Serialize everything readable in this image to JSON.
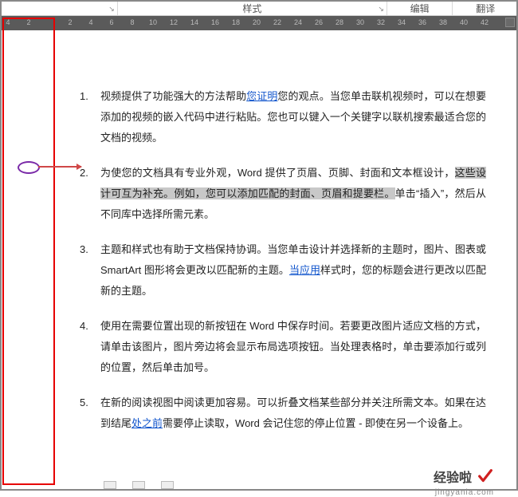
{
  "ribbon": {
    "styles_label": "样式",
    "edit_label": "编辑",
    "translate_label": "翻译"
  },
  "ruler": {
    "ticks": [
      "4",
      "2",
      "",
      "2",
      "4",
      "6",
      "8",
      "10",
      "12",
      "14",
      "16",
      "18",
      "20",
      "22",
      "24",
      "26",
      "28",
      "30",
      "32",
      "34",
      "36",
      "38",
      "40",
      "42"
    ]
  },
  "doc": {
    "items": [
      {
        "num": "1.",
        "pre": "视频提供了功能强大的方法帮助",
        "link1": "您证明",
        "post": "您的观点。当您单击联机视频时，可以在想要添加的视频的嵌入代码中进行粘贴。您也可以键入一个关键字以联机搜索最适合您的文档的视频。"
      },
      {
        "num": "2.",
        "pre": "为使您的文档具有专业外观，Word 提供了页眉、页脚、封面和文本框设计，",
        "hl": "这些设计可互为补充。例如，您可以添加匹配的封面、页眉和提要栏。",
        "post": "单击“插入”，然后从不同库中选择所需元素。"
      },
      {
        "num": "3.",
        "pre": "主题和样式也有助于文档保持协调。当您单击设计并选择新的主题时，图片、图表或 SmartArt 图形将会更改以匹配新的主题。",
        "link1": "当应用",
        "post": "样式时，您的标题会进行更改以匹配新的主题。"
      },
      {
        "num": "4.",
        "pre": "使用在需要位置出现的新按钮在 Word 中保存时间。若要更改图片适应文档的方式，请单击该图片，图片旁边将会显示布局选项按钮。当处理表格时，单击要添加行或列的位置，然后单击加号。"
      },
      {
        "num": "5.",
        "pre": "在新的阅读视图中阅读更加容易。可以折叠文档某些部分并关注所需文本。如果在达到结尾",
        "link1": "处之前",
        "post": "需要停止读取，Word 会记住您的停止位置 - 即使在另一个设备上。"
      }
    ]
  },
  "watermark": {
    "brand": "经验啦",
    "domain": "jingyanla.com"
  }
}
